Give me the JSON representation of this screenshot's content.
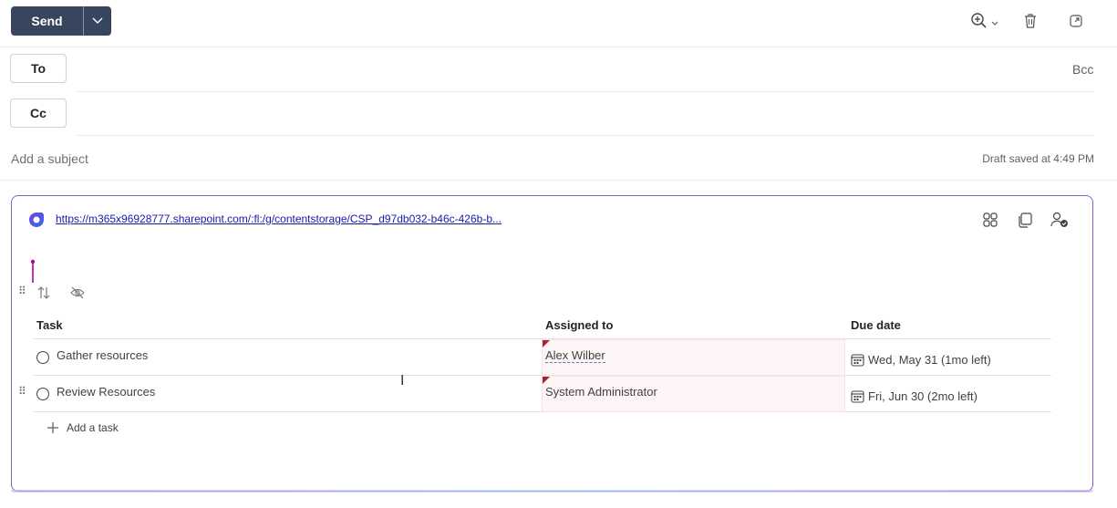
{
  "toolbar": {
    "send_label": "Send",
    "icons": [
      "zoom-in-icon",
      "chevron-down-icon",
      "delete-icon",
      "pop-out-icon"
    ]
  },
  "recipients": {
    "to_label": "To",
    "cc_label": "Cc",
    "bcc_label": "Bcc"
  },
  "subject": {
    "placeholder": "Add a subject",
    "draft_status": "Draft saved at 4:49 PM"
  },
  "loop_card": {
    "link": "https://m365x96928777.sharepoint.com/:fl:/g/contentstorage/CSP_d97db032-b46c-426b-b...",
    "icons": [
      "workspace-icon",
      "copy-icon",
      "share-icon"
    ],
    "table": {
      "columns": [
        "Task",
        "Assigned to",
        "Due date"
      ],
      "rows": [
        {
          "task": "Gather resources",
          "assigned": "Alex Wilber",
          "due": "Wed, May 31 (1mo left)"
        },
        {
          "task": "Review Resources",
          "assigned": "System Administrator",
          "due": "Fri, Jun 30 (2mo left)"
        }
      ],
      "add_task_label": "Add a task"
    }
  },
  "colors": {
    "send_bg": "#37455f",
    "card_border": "#8a5fc8",
    "link": "#1a1aa6",
    "flag": "#a4262c",
    "cursor_pin": "#b4009e"
  }
}
